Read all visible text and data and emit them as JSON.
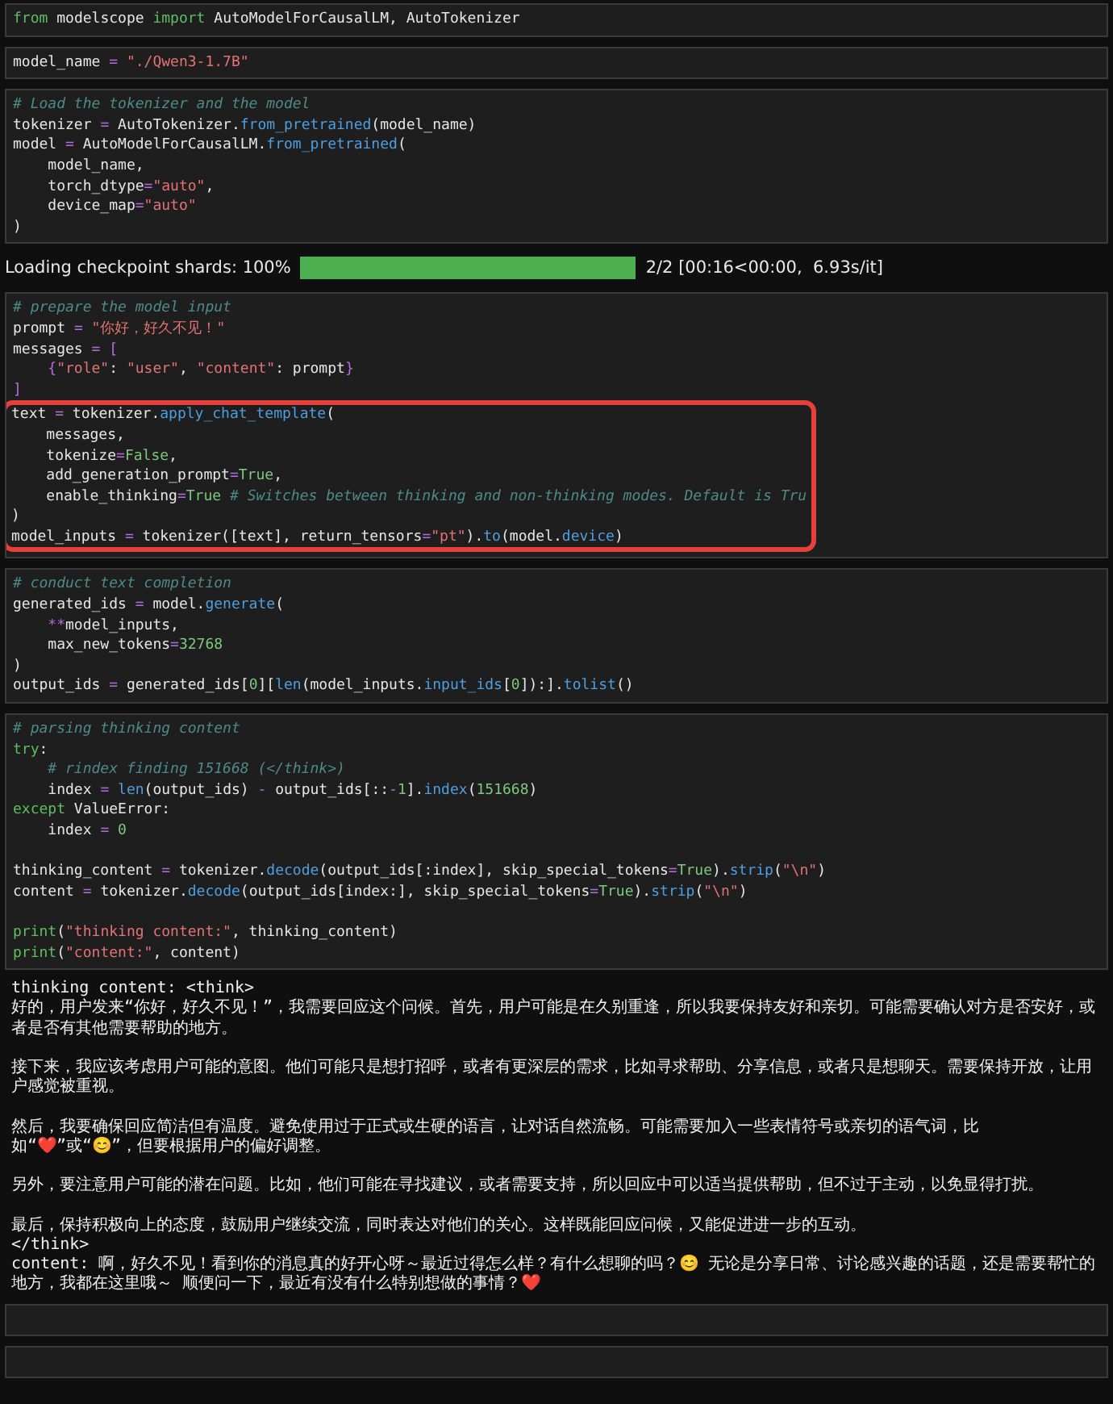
{
  "items": [
    {
      "kind": "code",
      "blocks": [
        {
          "highlighted": false,
          "gap_before": false,
          "lines": [
            [
              {
                "kind": "keyword",
                "text": "from"
              },
              {
                "kind": "name",
                "text": " modelscope "
              },
              {
                "kind": "keyword",
                "text": "import"
              },
              {
                "kind": "name",
                "text": " AutoModelForCausalLM, AutoTokenizer"
              }
            ]
          ]
        }
      ]
    },
    {
      "kind": "code",
      "blocks": [
        {
          "highlighted": false,
          "gap_before": false,
          "lines": [
            [
              {
                "kind": "name",
                "text": "model_name "
              },
              {
                "kind": "operator",
                "text": "="
              },
              {
                "kind": "string",
                "text": " \"./Qwen3-1.7B\""
              }
            ]
          ]
        }
      ]
    },
    {
      "kind": "code",
      "blocks": [
        {
          "highlighted": false,
          "gap_before": false,
          "lines": [
            [
              {
                "kind": "comment",
                "text": "# Load the tokenizer and the model"
              }
            ],
            [
              {
                "kind": "name",
                "text": "tokenizer "
              },
              {
                "kind": "operator",
                "text": "="
              },
              {
                "kind": "name",
                "text": " AutoTokenizer."
              },
              {
                "kind": "function",
                "text": "from_pretrained"
              },
              {
                "kind": "name",
                "text": "(model_name)"
              }
            ],
            [
              {
                "kind": "name",
                "text": "model "
              },
              {
                "kind": "operator",
                "text": "="
              },
              {
                "kind": "name",
                "text": " AutoModelForCausalLM."
              },
              {
                "kind": "function",
                "text": "from_pretrained"
              },
              {
                "kind": "name",
                "text": "("
              }
            ],
            [
              {
                "kind": "name",
                "text": "    model_name,"
              }
            ],
            [
              {
                "kind": "name",
                "text": "    torch_dtype"
              },
              {
                "kind": "operator",
                "text": "="
              },
              {
                "kind": "string",
                "text": "\"auto\""
              },
              {
                "kind": "name",
                "text": ","
              }
            ],
            [
              {
                "kind": "name",
                "text": "    device_map"
              },
              {
                "kind": "operator",
                "text": "="
              },
              {
                "kind": "string",
                "text": "\"auto\""
              }
            ],
            [
              {
                "kind": "name",
                "text": ")"
              }
            ]
          ]
        }
      ]
    },
    {
      "kind": "progress",
      "label": "Loading checkpoint shards: 100%",
      "level": 1,
      "reading": "2/2 [00:16<00:00,  6.93s/it]"
    },
    {
      "kind": "code",
      "blocks": [
        {
          "highlighted": false,
          "gap_before": false,
          "lines": [
            [
              {
                "kind": "comment",
                "text": "# prepare the model input"
              }
            ],
            [
              {
                "kind": "name",
                "text": "prompt "
              },
              {
                "kind": "operator",
                "text": "="
              },
              {
                "kind": "string",
                "text": " \"你好，好久不见！\""
              }
            ],
            [
              {
                "kind": "name",
                "text": "messages "
              },
              {
                "kind": "operator",
                "text": "= ["
              }
            ],
            [
              {
                "kind": "operator",
                "text": "    {"
              },
              {
                "kind": "string",
                "text": "\"role\""
              },
              {
                "kind": "name",
                "text": ": "
              },
              {
                "kind": "string",
                "text": "\"user\""
              },
              {
                "kind": "name",
                "text": ", "
              },
              {
                "kind": "string",
                "text": "\"content\""
              },
              {
                "kind": "name",
                "text": ": prompt"
              },
              {
                "kind": "operator",
                "text": "}"
              }
            ],
            [
              {
                "kind": "operator",
                "text": "]"
              }
            ]
          ]
        },
        {
          "highlighted": true,
          "gap_before": false,
          "lines": [
            [
              {
                "kind": "name",
                "text": "text "
              },
              {
                "kind": "operator",
                "text": "="
              },
              {
                "kind": "name",
                "text": " tokenizer."
              },
              {
                "kind": "function",
                "text": "apply_chat_template"
              },
              {
                "kind": "name",
                "text": "("
              }
            ],
            [
              {
                "kind": "name",
                "text": "    messages,"
              }
            ],
            [
              {
                "kind": "name",
                "text": "    tokenize"
              },
              {
                "kind": "operator",
                "text": "="
              },
              {
                "kind": "literal",
                "text": "False"
              },
              {
                "kind": "name",
                "text": ","
              }
            ],
            [
              {
                "kind": "name",
                "text": "    add_generation_prompt"
              },
              {
                "kind": "operator",
                "text": "="
              },
              {
                "kind": "literal",
                "text": "True"
              },
              {
                "kind": "name",
                "text": ","
              }
            ],
            [
              {
                "kind": "name",
                "text": "    enable_thinking"
              },
              {
                "kind": "operator",
                "text": "="
              },
              {
                "kind": "literal",
                "text": "True"
              },
              {
                "kind": "comment",
                "text": " # Switches between thinking and non-thinking modes. Default is Tru"
              }
            ],
            [
              {
                "kind": "name",
                "text": ")"
              }
            ],
            [
              {
                "kind": "name",
                "text": "model_inputs "
              },
              {
                "kind": "operator",
                "text": "="
              },
              {
                "kind": "name",
                "text": " tokenizer([text], return_tensors"
              },
              {
                "kind": "operator",
                "text": "="
              },
              {
                "kind": "string",
                "text": "\"pt\""
              },
              {
                "kind": "name",
                "text": ")."
              },
              {
                "kind": "function",
                "text": "to"
              },
              {
                "kind": "name",
                "text": "(model."
              },
              {
                "kind": "function",
                "text": "device"
              },
              {
                "kind": "name",
                "text": ")"
              }
            ]
          ]
        }
      ]
    },
    {
      "kind": "code",
      "blocks": [
        {
          "highlighted": false,
          "gap_before": false,
          "lines": [
            [
              {
                "kind": "comment",
                "text": "# conduct text completion"
              }
            ],
            [
              {
                "kind": "name",
                "text": "generated_ids "
              },
              {
                "kind": "operator",
                "text": "="
              },
              {
                "kind": "name",
                "text": " model."
              },
              {
                "kind": "function",
                "text": "generate"
              },
              {
                "kind": "name",
                "text": "("
              }
            ],
            [
              {
                "kind": "operator",
                "text": "    **"
              },
              {
                "kind": "name",
                "text": "model_inputs,"
              }
            ],
            [
              {
                "kind": "name",
                "text": "    max_new_tokens"
              },
              {
                "kind": "operator",
                "text": "="
              },
              {
                "kind": "literal",
                "text": "32768"
              }
            ],
            [
              {
                "kind": "name",
                "text": ")"
              }
            ],
            [
              {
                "kind": "name",
                "text": "output_ids "
              },
              {
                "kind": "operator",
                "text": "="
              },
              {
                "kind": "name",
                "text": " generated_ids["
              },
              {
                "kind": "literal",
                "text": "0"
              },
              {
                "kind": "name",
                "text": "]["
              },
              {
                "kind": "function",
                "text": "len"
              },
              {
                "kind": "name",
                "text": "(model_inputs."
              },
              {
                "kind": "function",
                "text": "input_ids"
              },
              {
                "kind": "name",
                "text": "["
              },
              {
                "kind": "literal",
                "text": "0"
              },
              {
                "kind": "name",
                "text": "]):]."
              },
              {
                "kind": "function",
                "text": "tolist"
              },
              {
                "kind": "name",
                "text": "()"
              }
            ]
          ]
        }
      ]
    },
    {
      "kind": "code",
      "blocks": [
        {
          "highlighted": false,
          "gap_before": false,
          "lines": [
            [
              {
                "kind": "comment",
                "text": "# parsing thinking content"
              }
            ],
            [
              {
                "kind": "keyword",
                "text": "try"
              },
              {
                "kind": "name",
                "text": ":"
              }
            ],
            [
              {
                "kind": "comment",
                "text": "    # rindex finding 151668 (</think>)"
              }
            ],
            [
              {
                "kind": "name",
                "text": "    index "
              },
              {
                "kind": "operator",
                "text": "="
              },
              {
                "kind": "function",
                "text": " len"
              },
              {
                "kind": "name",
                "text": "(output_ids) "
              },
              {
                "kind": "operator",
                "text": "-"
              },
              {
                "kind": "name",
                "text": " output_ids[::"
              },
              {
                "kind": "operator",
                "text": "-"
              },
              {
                "kind": "literal",
                "text": "1"
              },
              {
                "kind": "name",
                "text": "]."
              },
              {
                "kind": "function",
                "text": "index"
              },
              {
                "kind": "name",
                "text": "("
              },
              {
                "kind": "literal",
                "text": "151668"
              },
              {
                "kind": "name",
                "text": ")"
              }
            ],
            [
              {
                "kind": "keyword",
                "text": "except"
              },
              {
                "kind": "name",
                "text": " ValueError:"
              }
            ],
            [
              {
                "kind": "name",
                "text": "    index "
              },
              {
                "kind": "operator",
                "text": "="
              },
              {
                "kind": "literal",
                "text": " 0"
              }
            ]
          ]
        },
        {
          "highlighted": false,
          "gap_before": true,
          "lines": [
            [
              {
                "kind": "name",
                "text": "thinking_content "
              },
              {
                "kind": "operator",
                "text": "="
              },
              {
                "kind": "name",
                "text": " tokenizer."
              },
              {
                "kind": "function",
                "text": "decode"
              },
              {
                "kind": "name",
                "text": "(output_ids[:index], skip_special_tokens"
              },
              {
                "kind": "operator",
                "text": "="
              },
              {
                "kind": "literal",
                "text": "True"
              },
              {
                "kind": "name",
                "text": ")."
              },
              {
                "kind": "function",
                "text": "strip"
              },
              {
                "kind": "name",
                "text": "("
              },
              {
                "kind": "string",
                "text": "\"\\n\""
              },
              {
                "kind": "name",
                "text": ")"
              }
            ],
            [
              {
                "kind": "name",
                "text": "content "
              },
              {
                "kind": "operator",
                "text": "="
              },
              {
                "kind": "name",
                "text": " tokenizer."
              },
              {
                "kind": "function",
                "text": "decode"
              },
              {
                "kind": "name",
                "text": "(output_ids[index:], skip_special_tokens"
              },
              {
                "kind": "operator",
                "text": "="
              },
              {
                "kind": "literal",
                "text": "True"
              },
              {
                "kind": "name",
                "text": ")."
              },
              {
                "kind": "function",
                "text": "strip"
              },
              {
                "kind": "name",
                "text": "("
              },
              {
                "kind": "string",
                "text": "\"\\n\""
              },
              {
                "kind": "name",
                "text": ")"
              }
            ]
          ]
        },
        {
          "highlighted": false,
          "gap_before": true,
          "lines": [
            [
              {
                "kind": "keyword",
                "text": "print"
              },
              {
                "kind": "name",
                "text": "("
              },
              {
                "kind": "string",
                "text": "\"thinking content:\""
              },
              {
                "kind": "name",
                "text": ", thinking_content)"
              }
            ],
            [
              {
                "kind": "keyword",
                "text": "print"
              },
              {
                "kind": "name",
                "text": "("
              },
              {
                "kind": "string",
                "text": "\"content:\""
              },
              {
                "kind": "name",
                "text": ", content)"
              }
            ]
          ]
        }
      ]
    },
    {
      "kind": "output",
      "paragraphs": [
        {
          "gap_before": false,
          "text": "thinking content: <think>"
        },
        {
          "gap_before": false,
          "text": "好的，用户发来“你好，好久不见！”，我需要回应这个问候。首先，用户可能是在久别重逢，所以我要保持友好和亲切。可能需要确认对方是否安好，或者是否有其他需要帮助的地方。"
        },
        {
          "gap_before": true,
          "text": "接下来，我应该考虑用户可能的意图。他们可能只是想打招呼，或者有更深层的需求，比如寻求帮助、分享信息，或者只是想聊天。需要保持开放，让用户感觉被重视。"
        },
        {
          "gap_before": true,
          "text": "然后，我要确保回应简洁但有温度。避免使用过于正式或生硬的语言，让对话自然流畅。可能需要加入一些表情符号或亲切的语气词，比如“❤️”或“😊”，但要根据用户的偏好调整。"
        },
        {
          "gap_before": true,
          "text": "另外，要注意用户可能的潜在问题。比如，他们可能在寻找建议，或者需要支持，所以回应中可以适当提供帮助，但不过于主动，以免显得打扰。"
        },
        {
          "gap_before": true,
          "text": "最后，保持积极向上的态度，鼓励用户继续交流，同时表达对他们的关心。这样既能回应问候，又能促进进一步的互动。"
        },
        {
          "gap_before": false,
          "text": "</think>"
        },
        {
          "gap_before": false,
          "text": "content: 啊，好久不见！看到你的消息真的好开心呀～最近过得怎么样？有什么想聊的吗？😊 无论是分享日常、讨论感兴趣的话题，还是需要帮忙的地方，我都在这里哦～ 顺便问一下，最近有没有什么特别想做的事情？❤️"
        }
      ]
    },
    {
      "kind": "empty"
    },
    {
      "kind": "empty"
    }
  ]
}
